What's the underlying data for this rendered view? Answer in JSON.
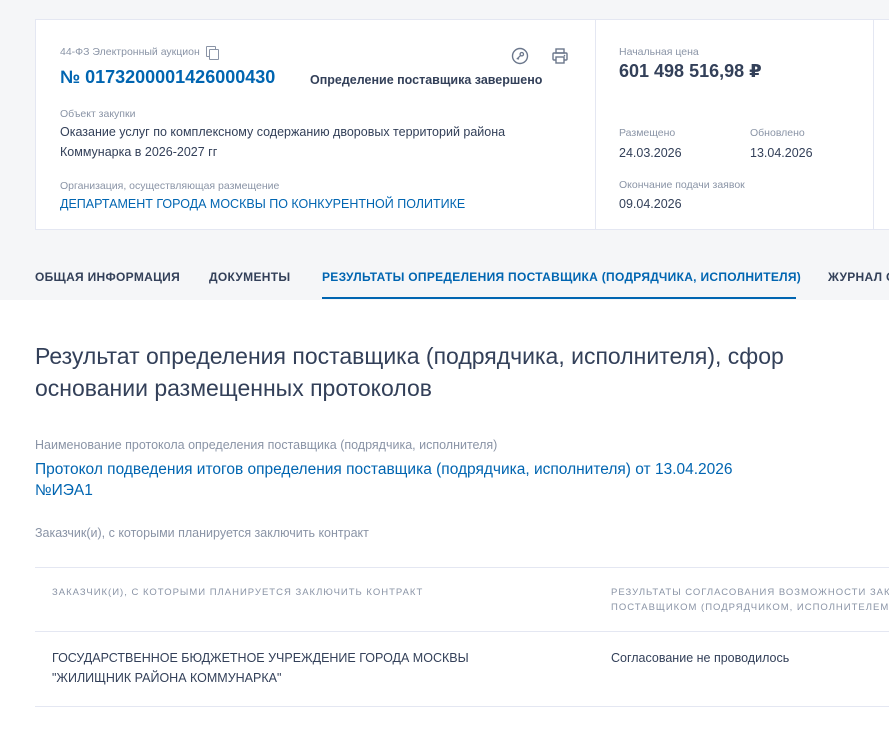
{
  "header": {
    "tender_type": "44-ФЗ  Электронный аукцион",
    "tender_number": "№ 0173200001426000430",
    "status": "Определение поставщика завершено",
    "subject_label": "Объект закупки",
    "subject_value": "Оказание услуг по комплексному содержанию дворовых территорий района Коммунарка в 2026-2027 гг",
    "org_label": "Организация, осуществляющая размещение",
    "org_value": "ДЕПАРТАМЕНТ ГОРОДА МОСКВЫ ПО КОНКУРЕНТНОЙ ПОЛИТИКЕ",
    "price_label": "Начальная цена",
    "price_value": "601 498 516,98 ₽",
    "placed_label": "Размещено",
    "placed_value": "24.03.2026",
    "updated_label": "Обновлено",
    "updated_value": "13.04.2026",
    "deadline_label": "Окончание подачи заявок",
    "deadline_value": "09.04.2026"
  },
  "tabs": [
    {
      "label": "ОБЩАЯ ИНФОРМАЦИЯ",
      "active": false
    },
    {
      "label": "ДОКУМЕНТЫ",
      "active": false
    },
    {
      "label": "РЕЗУЛЬТАТЫ ОПРЕДЕЛЕНИЯ ПОСТАВЩИКА (ПОДРЯДЧИКА, ИСПОЛНИТЕЛЯ)",
      "active": true
    },
    {
      "label": "ЖУРНАЛ С",
      "active": false
    }
  ],
  "main": {
    "title_line1": "Результат определения поставщика (подрядчика, исполнителя), сфор",
    "title_line2": "основании размещенных протоколов",
    "protocol_label": "Наименование протокола определения поставщика (подрядчика, исполнителя)",
    "protocol_link_line1": "Протокол подведения итогов определения поставщика (подрядчика, исполнителя) от 13.04.2026",
    "protocol_link_line2": "№ИЭА1",
    "customers_label": "Заказчик(и), с которыми планируется заключить контракт",
    "table": {
      "headers": [
        [
          "ЗАКАЗЧИК(И), С КОТОРЫМИ ПЛАНИРУЕТСЯ ЗАКЛЮЧИТЬ КОНТРАКТ"
        ],
        [
          "РЕЗУЛЬТАТЫ СОГЛАСОВАНИЯ ВОЗМОЖНОСТИ ЗАК",
          "ПОСТАВЩИКОМ (ПОДРЯДЧИКОМ, ИСПОЛНИТЕЛЕМ"
        ]
      ],
      "rows": [
        {
          "customer_line1": "ГОСУДАРСТВЕННОЕ БЮДЖЕТНОЕ УЧРЕЖДЕНИЕ ГОРОДА МОСКВЫ",
          "customer_line2": "\"ЖИЛИЩНИК РАЙОНА КОММУНАРКА\"",
          "result": "Согласование не проводилось"
        }
      ]
    }
  },
  "icons": {
    "copy": "copy-icon",
    "key": "key-icon",
    "print": "printer-icon"
  },
  "colors": {
    "accent": "#0065b1",
    "text": "#334059",
    "muted": "#8a94a6",
    "background": "#f5f6f8"
  }
}
